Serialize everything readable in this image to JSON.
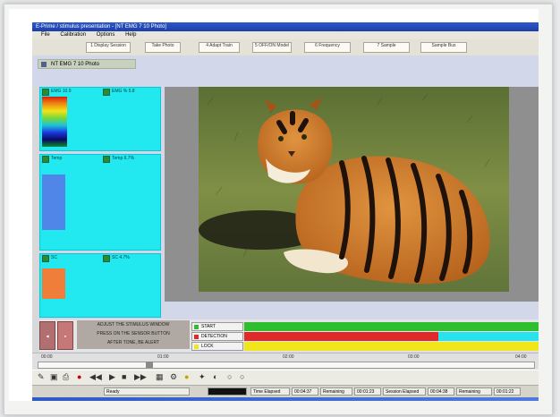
{
  "window": {
    "title": "E-Prime / stimulus presentation - [NT EMG 7 10 Photo]"
  },
  "menu": [
    "File",
    "Calibration",
    "Options",
    "Help"
  ],
  "toolbar": {
    "buttons": [
      "1 Display Session",
      "Take Photo",
      "4 Adapt Train",
      "5 OFF/ON Model",
      "6 Frequency",
      "7 Sample",
      "Sample Bus"
    ]
  },
  "content": {
    "header": "NT EMG 7 10 Photo"
  },
  "panels": [
    {
      "label_a": "EMG 10.9",
      "label_b": "EMG %  5.8",
      "fill": "rainbow"
    },
    {
      "label_a": "Temp",
      "label_b": "Temp  6.7%",
      "fill": "#4f86e8"
    },
    {
      "label_a": "SC",
      "label_b": "SC  4.7%",
      "fill": "#ef7e3a"
    }
  ],
  "instructions": [
    "ADJUST THE STIMULUS WINDOW",
    "PRESS ON THE SENSOR BUTTON",
    "AFTER TONE, BE ALERT"
  ],
  "tracks": [
    {
      "label": "START",
      "color": "#2fbe2f",
      "value": 1.0
    },
    {
      "label": "DETECTION",
      "color": "#e02a2a",
      "value": 0.66
    },
    {
      "label": "LOCK",
      "color": "#f0e61a",
      "value": 1.0
    }
  ],
  "timeline": {
    "labels": [
      "00:00",
      "01:00",
      "02:00",
      "03:00",
      "04:00"
    ],
    "position": 0.22
  },
  "status": {
    "cells": [
      "Ready",
      "Time Elapsed",
      "00:04:37",
      "Remaining",
      "00:01:23",
      "Session Elapsed",
      "00:04:38",
      "Remaining",
      "00:01:22"
    ]
  },
  "icons": [
    "tiger-photo-icon",
    "play-icon",
    "stop-icon",
    "record-icon",
    "rewind-icon",
    "forward-icon",
    "settings-icon"
  ]
}
